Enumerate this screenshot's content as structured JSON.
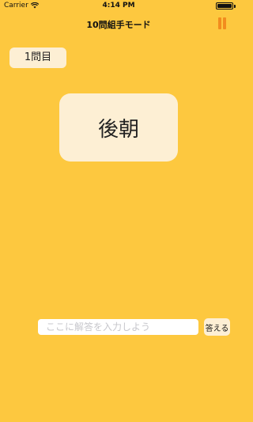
{
  "status_bar": {
    "carrier": "Carrier",
    "time": "4:14 PM"
  },
  "nav": {
    "title": "10問組手モード"
  },
  "quiz": {
    "question_number": "1問目",
    "question_text": "後朝",
    "answer_placeholder": "ここに解答を入力しよう",
    "answer_value": "",
    "submit_label": "答える"
  },
  "colors": {
    "background": "#FDC83F",
    "card": "#FDEFD4",
    "pause_accent": "#F28C1E"
  }
}
